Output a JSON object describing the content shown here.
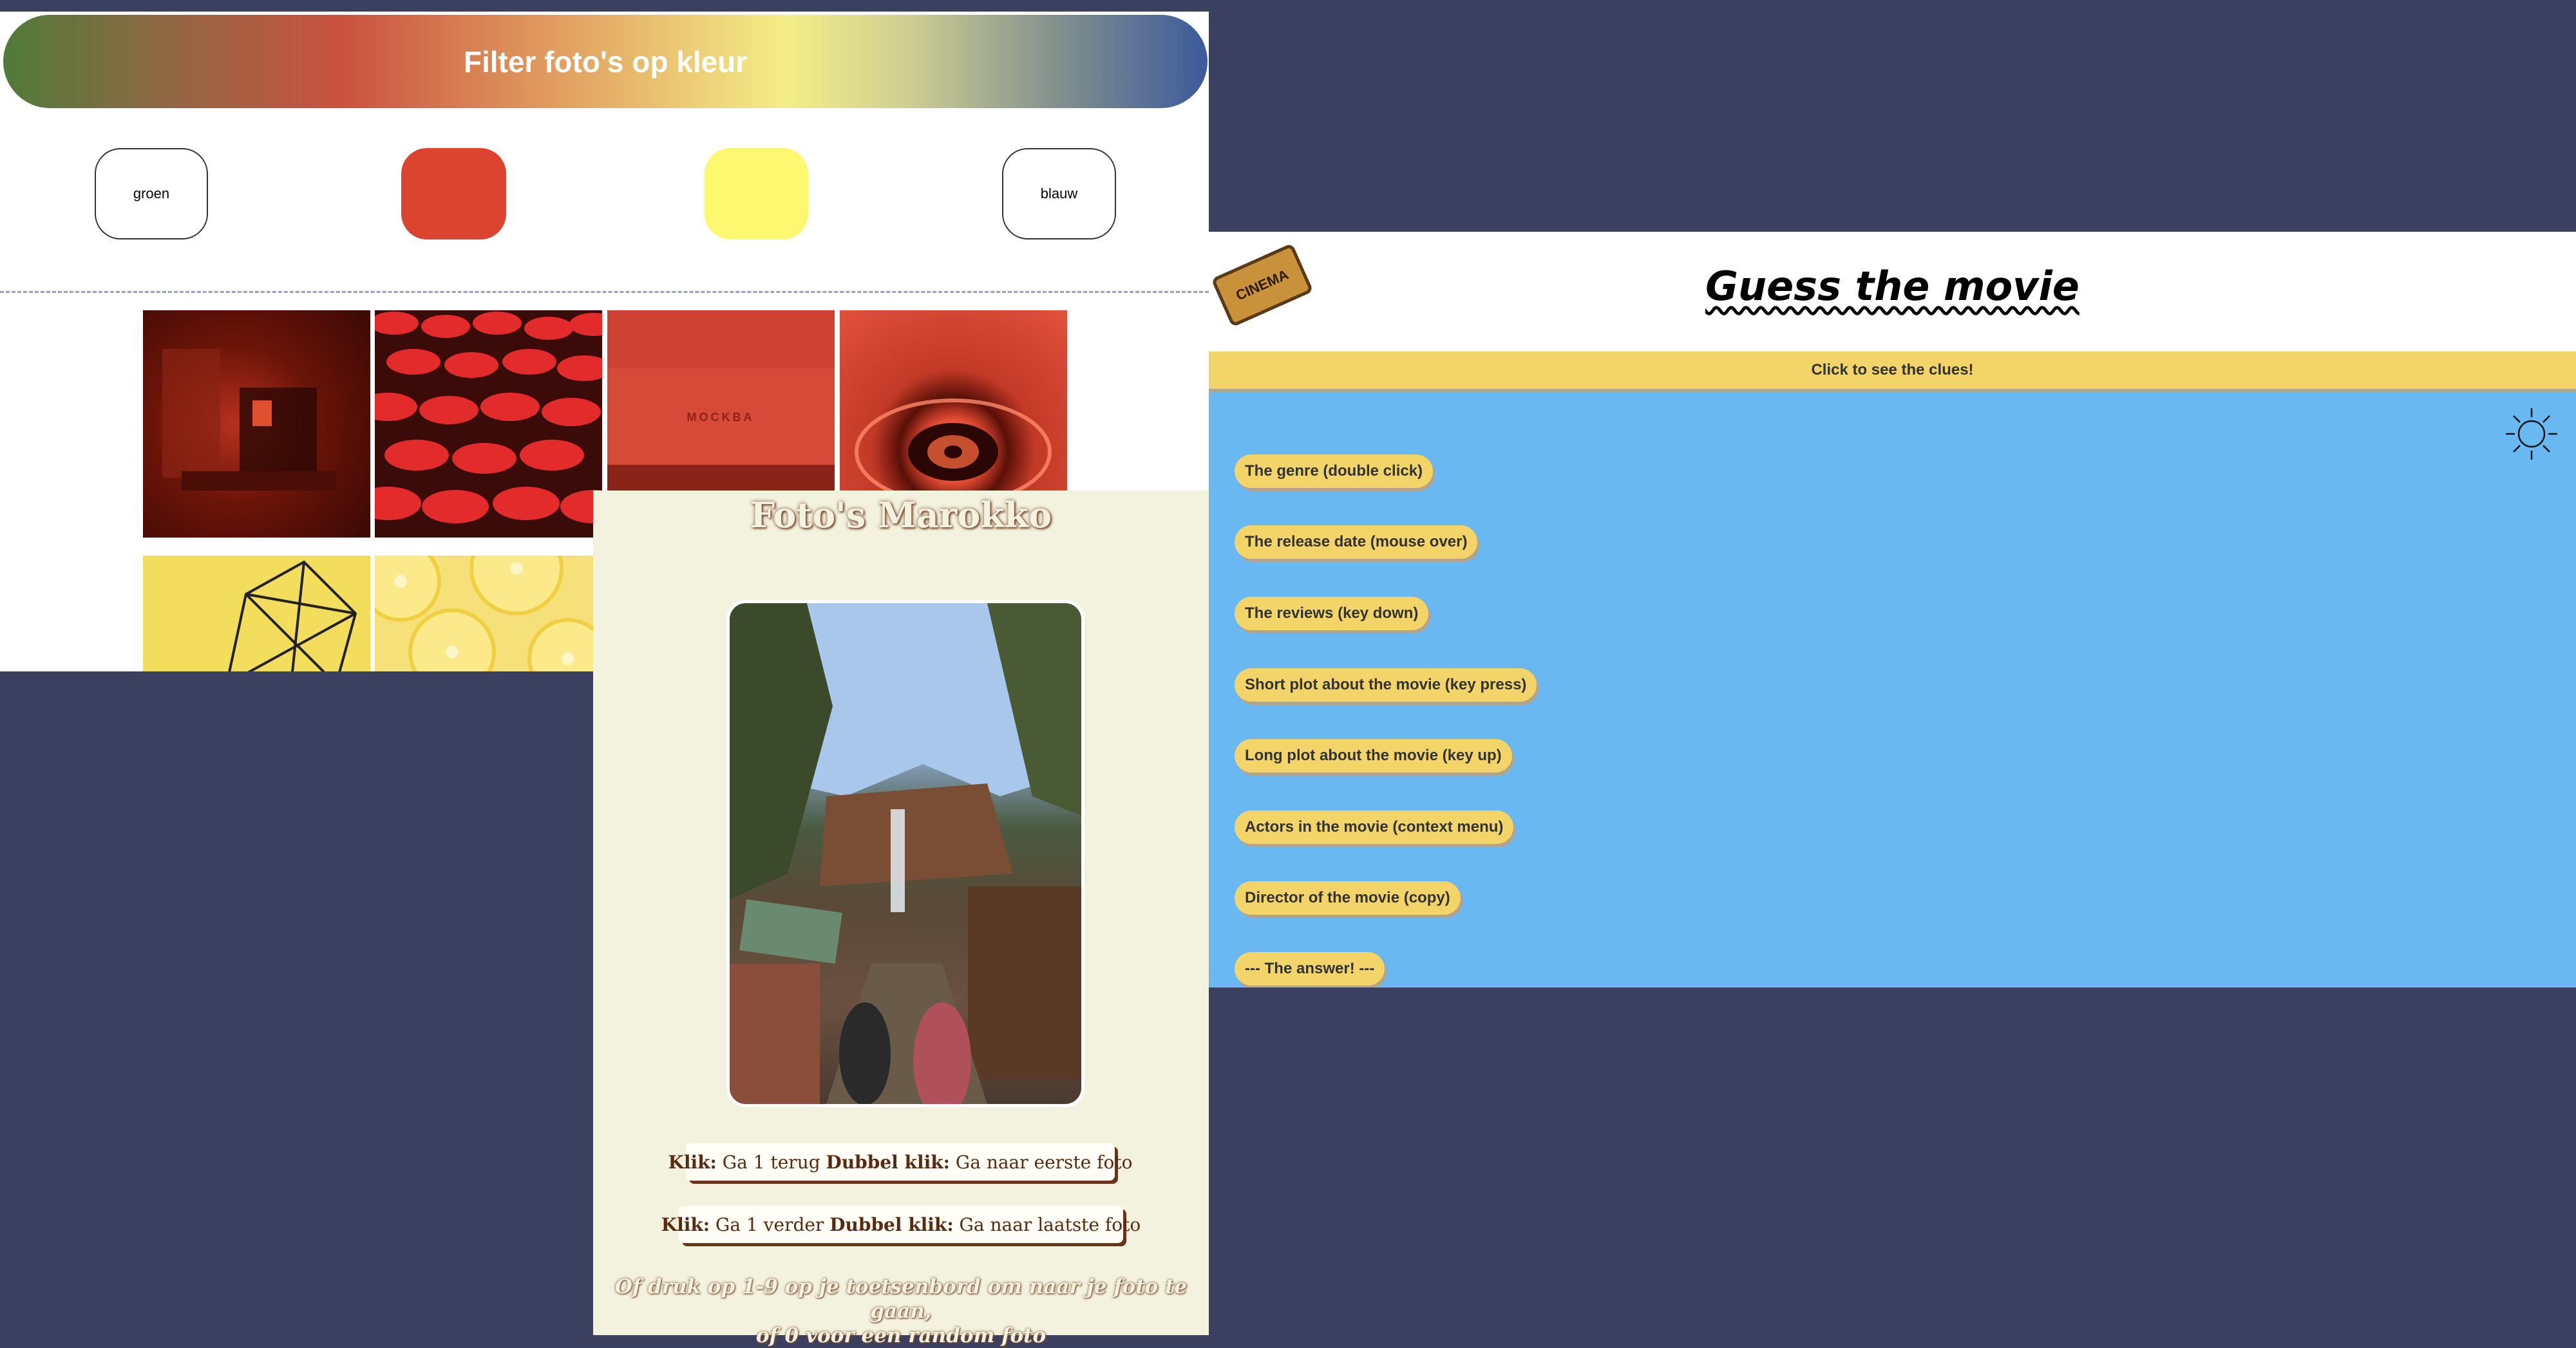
{
  "filter": {
    "title": "Filter foto's op kleur",
    "buttons": {
      "green": "groen",
      "red": "",
      "yellow": "",
      "blue": "blauw"
    },
    "colors": {
      "red": "#dd4430",
      "yellow": "#fdf870"
    },
    "piano_brand": "MOCKBA"
  },
  "marokko": {
    "title": "Foto's Marokko",
    "back": {
      "click_label": "Klik:",
      "click_text": " Ga 1 terug ",
      "dbl_label": "Dubbel klik:",
      "dbl_text": " Ga naar eerste foto"
    },
    "forward": {
      "click_label": "Klik:",
      "click_text": " Ga 1 verder ",
      "dbl_label": "Dubbel klik:",
      "dbl_text": " Ga naar laatste foto"
    },
    "hint_line1": "Of druk op 1-9 op je toetsenbord om naar je foto te gaan,",
    "hint_line2": "of 0 voor een random foto"
  },
  "movie": {
    "logo_text": "CINEMA",
    "title": "Guess the movie",
    "clue_bar": "Click to see the clues!",
    "clues": [
      "The genre (double click)",
      "The release date (mouse over)",
      "The reviews (key down)",
      "Short plot about the movie (key press)",
      "Long plot about the movie (key up)",
      "Actors in the movie (context menu)",
      "Director of the movie (copy)",
      "--- The answer! ---"
    ],
    "colors": {
      "background": "#6ab8f2",
      "accent": "#f2d469"
    }
  }
}
